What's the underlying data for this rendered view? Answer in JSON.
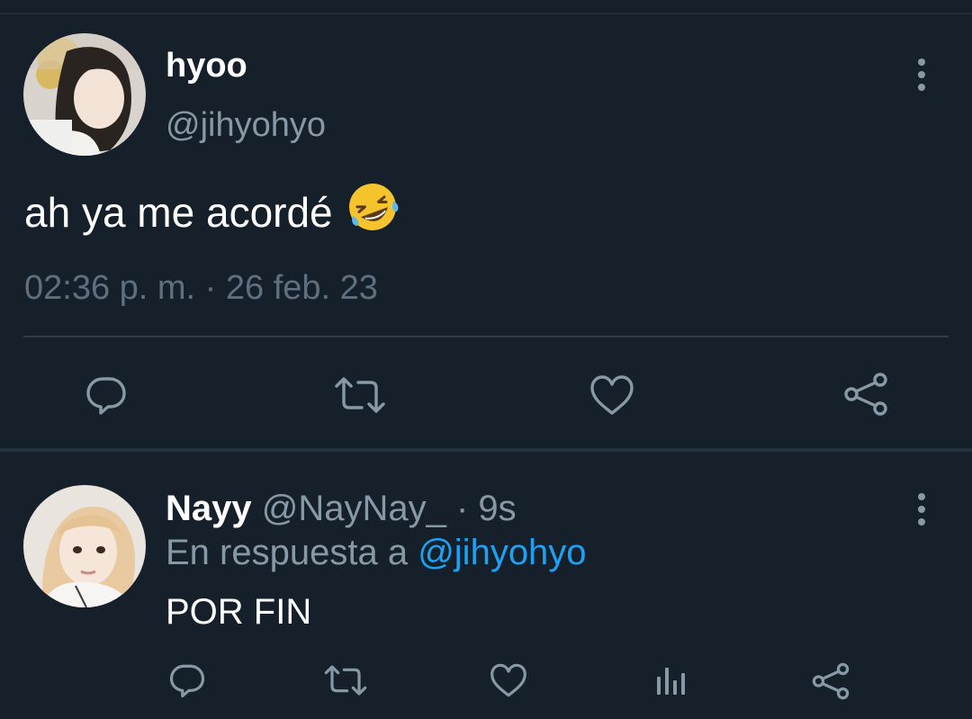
{
  "main_tweet": {
    "display_name": "hyoo",
    "handle": "@jihyohyo",
    "text": "ah ya me acordé",
    "emoji": "rolling-on-the-floor-laughing",
    "timestamp": "02:36 p. m. · 26 feb. 23",
    "actions": [
      "reply-icon",
      "retweet-icon",
      "like-icon",
      "share-icon"
    ]
  },
  "reply": {
    "display_name": "Nayy",
    "handle_time": "@NayNay_ · 9s",
    "reply_to_prefix": "En respuesta a ",
    "reply_to_handle": "@jihyohyo",
    "text": "POR FIN",
    "actions": [
      "reply-icon",
      "retweet-icon",
      "like-icon",
      "analytics-icon",
      "share-icon"
    ]
  },
  "colors": {
    "background": "#15202b",
    "primary_text": "#ffffff",
    "secondary_text": "#8899a6",
    "icon": "#8899a6",
    "link": "#1da1f2"
  }
}
